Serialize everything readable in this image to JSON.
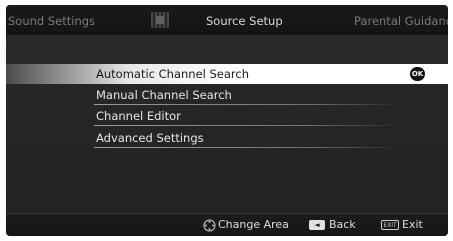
{
  "tabs": {
    "left": "Sound Settings",
    "center": "Source Setup",
    "right": "Parental Guidance"
  },
  "menu": {
    "items": [
      {
        "label": "Automatic Channel Search",
        "selected": true
      },
      {
        "label": "Manual Channel Search",
        "selected": false
      },
      {
        "label": "Channel Editor",
        "selected": false
      },
      {
        "label": "Advanced Settings",
        "selected": false
      }
    ],
    "ok_label": "OK"
  },
  "footer": {
    "change_area": "Change Area",
    "back_key": "◄",
    "back": "Back",
    "exit_key": "EXIT",
    "exit": "Exit"
  },
  "colors": {
    "background": "#262626",
    "selected_highlight": "#ffffff",
    "text": "#e6e6e6"
  }
}
